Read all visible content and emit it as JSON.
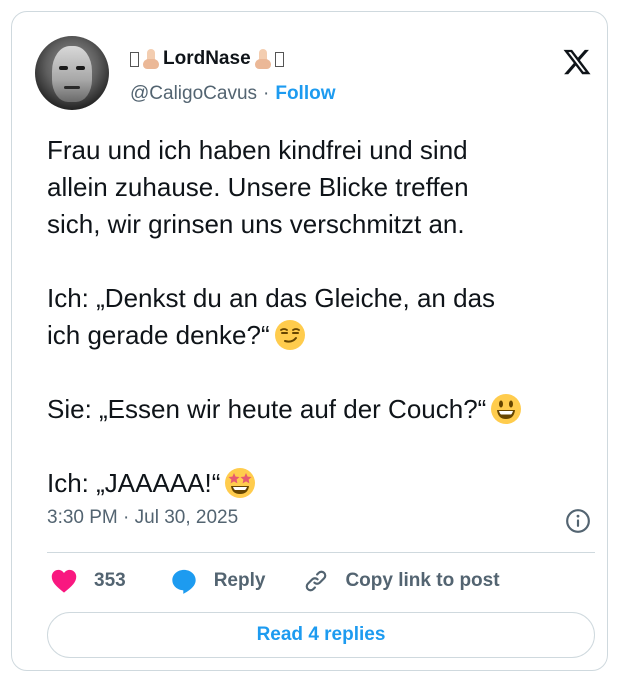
{
  "author": {
    "display_name": "LordNase",
    "handle": "@CaligoCavus",
    "separator": "·",
    "follow_label": "Follow"
  },
  "tweet": {
    "paragraphs": [
      "Frau und ich haben kindfrei und sind",
      "allein zuhause. Unsere Blicke treffen",
      "sich, wir grinsen uns verschmitzt an.",
      "Ich: „Denkst du an das Gleiche, an das",
      "ich gerade denke?“",
      "Sie: „Essen wir heute auf der Couch?“",
      "Ich: „JAAAAA!“"
    ],
    "emojis": [
      "smirking-face-emoji",
      "grinning-face-emoji",
      "star-struck-emoji"
    ],
    "timestamp": "3:30 PM · Jul 30, 2025"
  },
  "actions": {
    "likes": "353",
    "reply_label": "Reply",
    "copy_label": "Copy link to post"
  },
  "read_replies_label": "Read 4 replies",
  "colors": {
    "accent": "#1d9bf0",
    "like": "#f91880",
    "text": "#0f1419",
    "muted": "#536471",
    "border": "#cfd9de"
  }
}
